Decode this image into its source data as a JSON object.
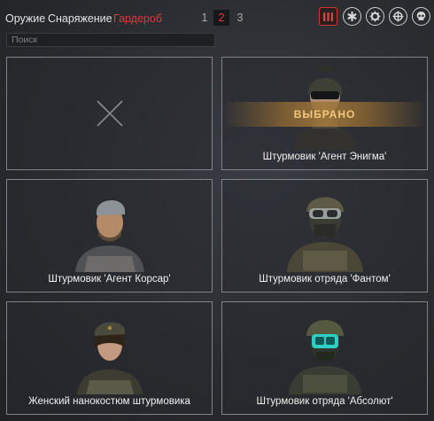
{
  "tabs": [
    {
      "label": "Оружие",
      "active": false
    },
    {
      "label": "Снаряжение",
      "active": false
    },
    {
      "label": "Гардероб",
      "active": true
    }
  ],
  "pages": [
    "1",
    "2",
    "3"
  ],
  "active_page": "2",
  "class_filters": [
    {
      "icon": "ammo-icon",
      "active": true
    },
    {
      "icon": "medic-icon",
      "active": false
    },
    {
      "icon": "engineer-icon",
      "active": false
    },
    {
      "icon": "sniper-icon",
      "active": false
    },
    {
      "icon": "skull-icon",
      "active": false
    }
  ],
  "search": {
    "placeholder": "Поиск"
  },
  "cards": [
    {
      "label": "",
      "empty": true
    },
    {
      "label": "Штурмовик 'Агент Энигма'",
      "badge": "ВЫБРАНО",
      "selected": true
    },
    {
      "label": "Штурмовик 'Агент Корсар'"
    },
    {
      "label": "Штурмовик отряда 'Фантом'"
    },
    {
      "label": "Женский нанокостюм штурмовика"
    },
    {
      "label": "Штурмовик отряда 'Абсолют'"
    }
  ],
  "colors": {
    "accent": "#e0383a",
    "selected_text": "#f2c77a",
    "card_border": "#7f8288"
  }
}
